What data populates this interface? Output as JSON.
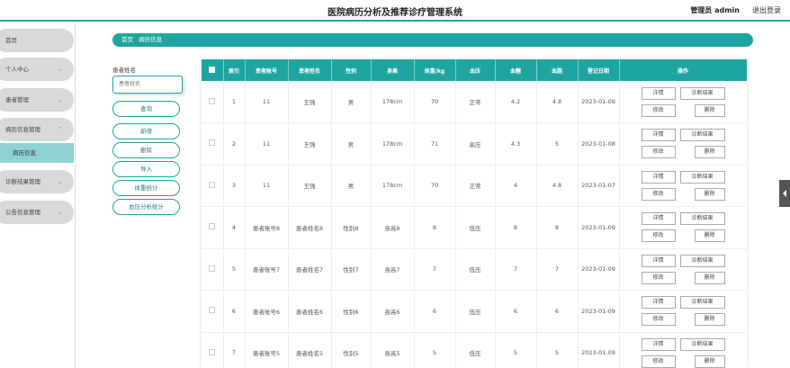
{
  "header": {
    "title": "医院病历分析及推荐诊疗管理系统",
    "admin": "管理员 admin",
    "logout": "退出登录"
  },
  "sidebar": {
    "items": [
      {
        "label": "首页"
      },
      {
        "label": "个人中心"
      },
      {
        "label": "患者管理"
      },
      {
        "label": "病历信息管理"
      },
      {
        "label": "诊断结果管理"
      },
      {
        "label": "公告信息管理"
      }
    ],
    "subitem": "病历信息"
  },
  "breadcrumb": {
    "home": "首页",
    "current": "病历信息"
  },
  "search": {
    "label": "患者姓名",
    "placeholder": "患者姓名"
  },
  "actions": {
    "query": "查询",
    "add": "新增",
    "delete": "删除",
    "import": "导入",
    "weight_stats": "体重统计",
    "bp_stats": "血压分析统计"
  },
  "table": {
    "headers": [
      "索引",
      "患者账号",
      "患者姓名",
      "性别",
      "身高",
      "体重/kg",
      "血压",
      "血糖",
      "血脂",
      "登记日期",
      "操作"
    ],
    "rows": [
      [
        "1",
        "11",
        "王强",
        "男",
        "178cm",
        "70",
        "正常",
        "4.2",
        "4.8",
        "2023-01-09"
      ],
      [
        "2",
        "11",
        "王强",
        "男",
        "178cm",
        "71",
        "高压",
        "4.3",
        "5",
        "2023-01-08"
      ],
      [
        "3",
        "11",
        "王强",
        "男",
        "178cm",
        "70",
        "正常",
        "4",
        "4.8",
        "2023-01-07"
      ],
      [
        "4",
        "患者账号8",
        "患者姓名8",
        "性别8",
        "身高8",
        "8",
        "低压",
        "8",
        "8",
        "2023-01-09"
      ],
      [
        "5",
        "患者账号7",
        "患者姓名7",
        "性别7",
        "身高7",
        "7",
        "低压",
        "7",
        "7",
        "2023-01-09"
      ],
      [
        "6",
        "患者账号6",
        "患者姓名6",
        "性别6",
        "身高6",
        "6",
        "低压",
        "6",
        "6",
        "2023-01-09"
      ],
      [
        "7",
        "患者账号5",
        "患者姓名5",
        "性别5",
        "身高5",
        "5",
        "低压",
        "5",
        "5",
        "2023-01-09"
      ]
    ],
    "row_buttons": {
      "detail": "详情",
      "diagnosis": "诊断结果",
      "edit": "修改",
      "delete": "删除"
    }
  },
  "colors": {
    "accent": "#1fa5a1",
    "submenu_active": "#8ed3d1",
    "menu_bg": "#d9d9d9"
  }
}
